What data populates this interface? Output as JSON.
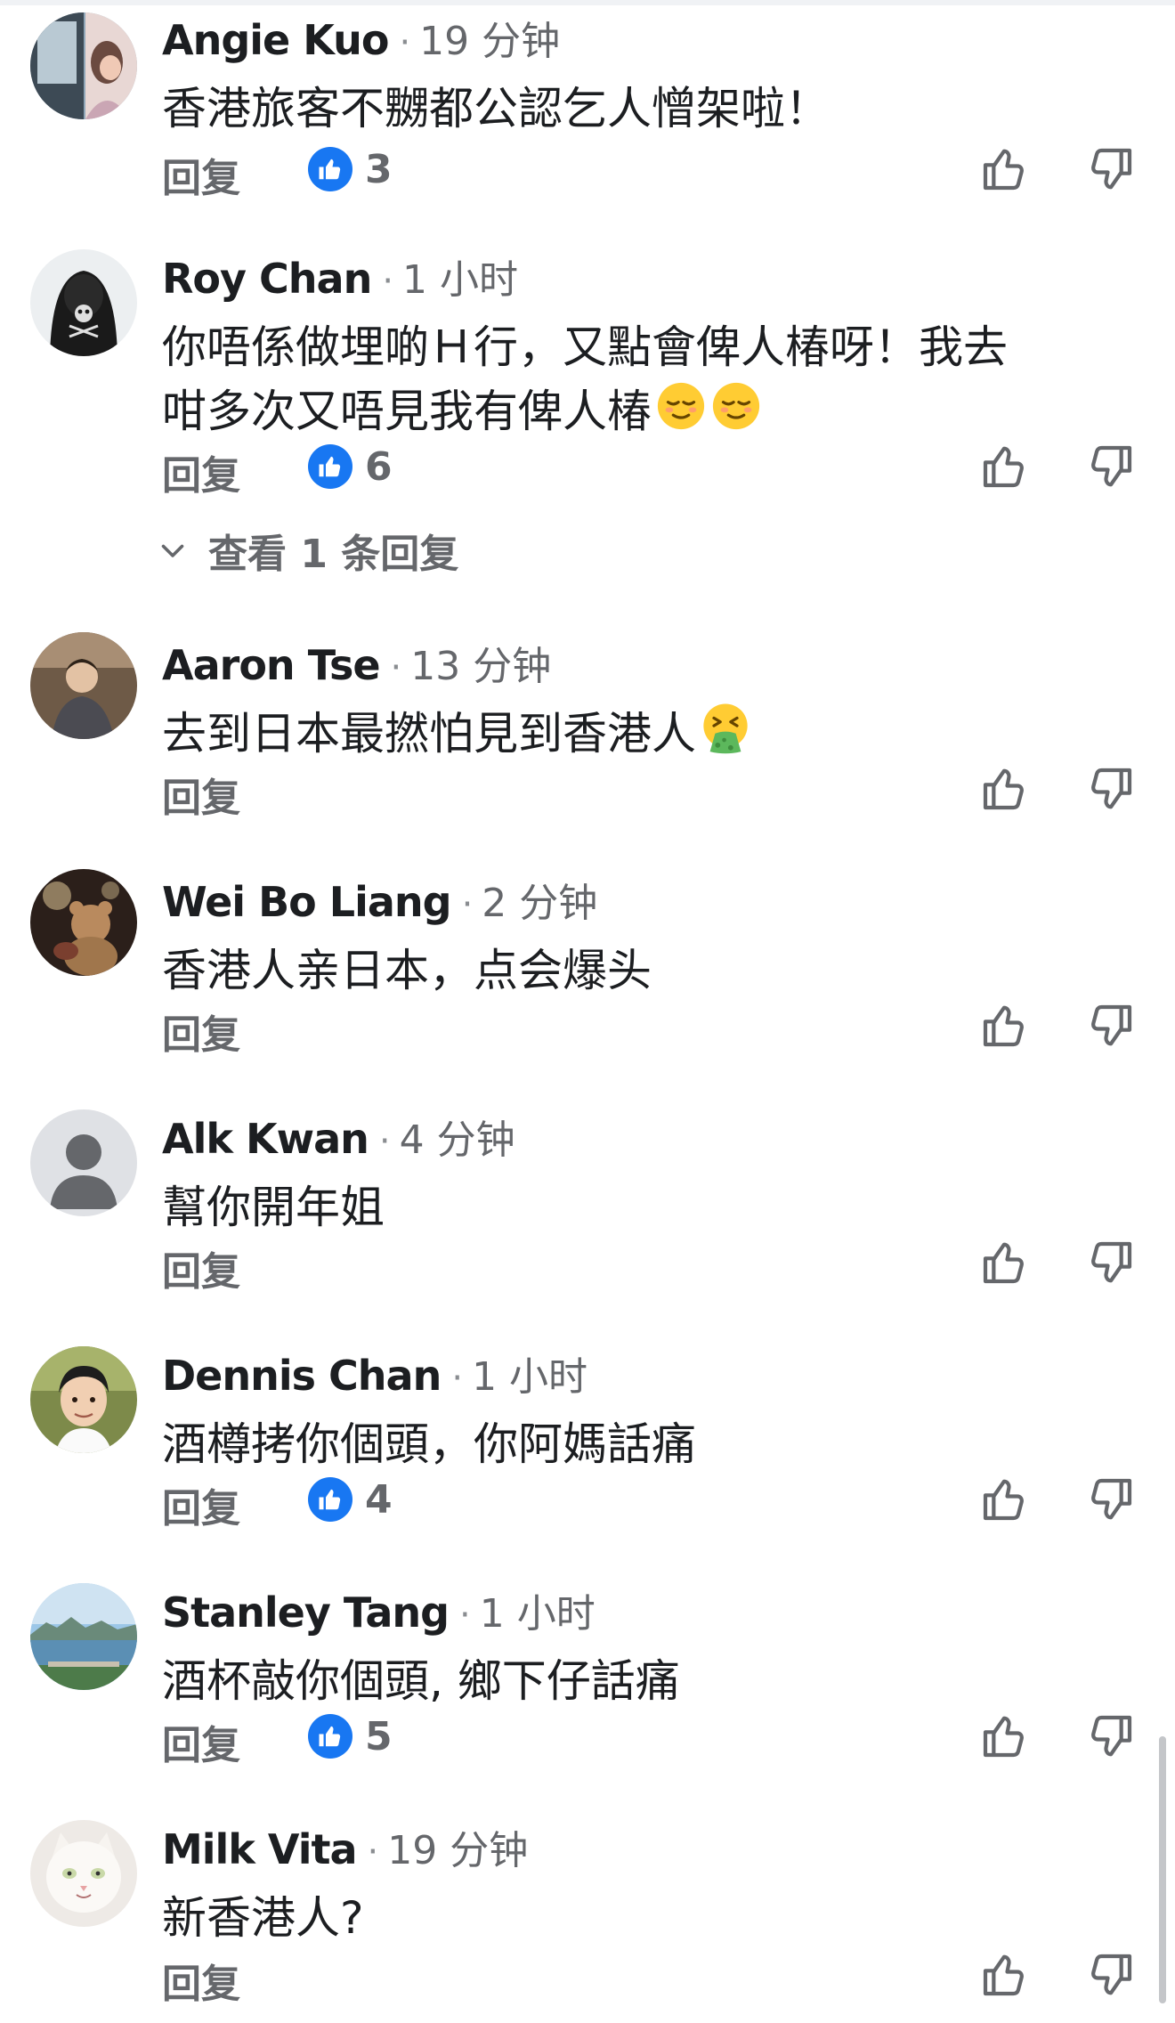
{
  "comments": [
    {
      "author": "Angie Kuo",
      "time": "19 分钟",
      "text_lines": [
        "香港旅客不嬲都公認乞人憎架啦！"
      ],
      "reply_label": "回复",
      "like_count": "3",
      "avatar_icon": "profile-photo-window"
    },
    {
      "author": "Roy Chan",
      "time": "1 小时",
      "text_lines": [
        "你唔係做埋啲Ｈ行，又點會俾人椿呀！我去",
        "咁多次又唔見我有俾人椿"
      ],
      "emojis": [
        "relieved-face-emoji",
        "relieved-face-emoji"
      ],
      "reply_label": "回复",
      "like_count": "6",
      "view_replies_label": "查看 1 条回复",
      "avatar_icon": "profile-photo-hoodie"
    },
    {
      "author": "Aaron Tse",
      "time": "13 分钟",
      "text_lines": [
        "去到日本最撚怕見到香港人"
      ],
      "emojis": [
        "vomiting-face-emoji"
      ],
      "reply_label": "回复",
      "avatar_icon": "profile-photo-person"
    },
    {
      "author": "Wei Bo Liang",
      "time": "2 分钟",
      "text_lines": [
        "香港人亲日本，点会爆头"
      ],
      "reply_label": "回复",
      "avatar_icon": "profile-photo-teddy"
    },
    {
      "author": "Alk Kwan",
      "time": "4 分钟",
      "text_lines": [
        "幫你開年姐"
      ],
      "reply_label": "回复",
      "avatar_icon": "default-avatar-icon"
    },
    {
      "author": "Dennis Chan",
      "time": "1 小时",
      "text_lines": [
        "酒樽拷你個頭，你阿媽話痛"
      ],
      "reply_label": "回复",
      "like_count": "4",
      "avatar_icon": "profile-photo-face"
    },
    {
      "author": "Stanley Tang",
      "time": "1 小时",
      "text_lines": [
        "酒杯敲你個頭, 鄉下仔話痛"
      ],
      "reply_label": "回复",
      "like_count": "5",
      "avatar_icon": "profile-photo-harbour"
    },
    {
      "author": "Milk Vita",
      "time": "19 分钟",
      "text_lines": [
        "新香港人?"
      ],
      "reply_label": "回复",
      "avatar_icon": "profile-photo-cat"
    }
  ],
  "icons": {
    "thumb_up": "thumb-up-icon",
    "thumb_down": "thumb-down-icon",
    "like_badge": "like-reaction-icon",
    "view_replies": "chevron-down-icon"
  },
  "colors": {
    "like_blue": "#1877f2",
    "secondary_text": "#65676b",
    "primary_text": "#1c1e21"
  }
}
